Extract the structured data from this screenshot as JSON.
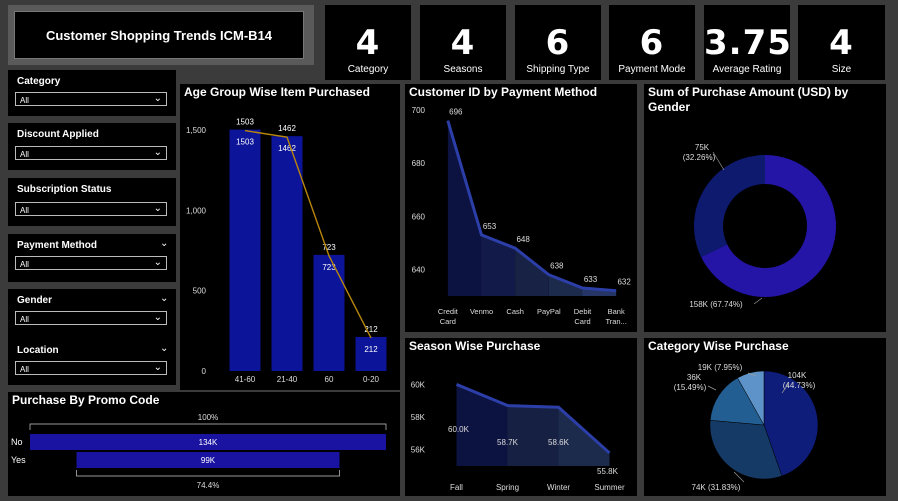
{
  "dashboard_title": "Customer Shopping Trends ICM-B14",
  "kpis": [
    {
      "value": "4",
      "label": "Category"
    },
    {
      "value": "4",
      "label": "Seasons"
    },
    {
      "value": "6",
      "label": "Shipping Type"
    },
    {
      "value": "6",
      "label": "Payment Mode"
    },
    {
      "value": "3.75",
      "label": "Average Rating"
    },
    {
      "value": "4",
      "label": "Size"
    }
  ],
  "slicers": [
    {
      "label": "Category",
      "value": "All"
    },
    {
      "label": "Discount Applied",
      "value": "All"
    },
    {
      "label": "Subscription Status",
      "value": "All"
    },
    {
      "label": "Payment Method",
      "value": "All"
    },
    {
      "label": "Gender",
      "value": "All"
    },
    {
      "label": "Location",
      "value": "All"
    }
  ],
  "chart_data": [
    {
      "type": "bar",
      "title": "Age Group Wise Item Purchased",
      "categories": [
        "41-60",
        "21-40",
        "60",
        "0-20"
      ],
      "values": [
        1503,
        1462,
        723,
        212
      ],
      "yticks": [
        "1,500",
        "1,000",
        "500",
        "0"
      ],
      "ylim": [
        0,
        1600
      ],
      "colors": {
        "bar": "#0c1499",
        "line": "#b8860b"
      }
    },
    {
      "type": "area",
      "title": "Customer ID by Payment Method",
      "categories": [
        "Credit Card",
        "Venmo",
        "Cash",
        "PayPal",
        "Debit Card",
        "Bank Tran..."
      ],
      "values": [
        696,
        653,
        648,
        638,
        633,
        632
      ],
      "yticks": [
        "700",
        "680",
        "660",
        "640"
      ],
      "ylim": [
        630,
        700
      ],
      "colors": {
        "line": "#2c3ea8"
      }
    },
    {
      "type": "pie",
      "title": "Sum of Purchase Amount (USD) by Gender",
      "slices": [
        {
          "value": 158,
          "label": "158K (67.74%)",
          "color": "#2415a6"
        },
        {
          "value": 75,
          "label": "75K (32.26%)",
          "color": "#0d1a6e"
        }
      ]
    },
    {
      "type": "bar",
      "title": "Purchase By Promo Code",
      "categories": [
        "No",
        "Yes"
      ],
      "values": [
        134,
        99
      ],
      "data_labels": [
        "134K",
        "99K"
      ],
      "top_label": "100%",
      "bottom_label": "74.4%",
      "colors": {
        "bar": "#1a12a0"
      }
    },
    {
      "type": "area",
      "title": "Season Wise Purchase",
      "categories": [
        "Fall",
        "Spring",
        "Winter",
        "Summer"
      ],
      "values": [
        60.0,
        58.7,
        58.6,
        55.8
      ],
      "data_labels": [
        "60.0K",
        "58.7K",
        "58.6K",
        "55.8K"
      ],
      "yticks": [
        "60K",
        "58K",
        "56K"
      ],
      "ylim": [
        55,
        61
      ],
      "colors": {
        "line": "#2c3ea8"
      }
    },
    {
      "type": "pie",
      "title": "Category Wise Purchase",
      "slices": [
        {
          "value": 104,
          "label": "104K (44.73%)",
          "color": "#0f1d7a"
        },
        {
          "value": 74,
          "label": "74K (31.83%)",
          "color": "#163a66"
        },
        {
          "value": 36,
          "label": "36K (15.49%)",
          "color": "#235e93"
        },
        {
          "value": 19,
          "label": "19K (7.95%)",
          "color": "#5d93c9"
        }
      ]
    }
  ]
}
